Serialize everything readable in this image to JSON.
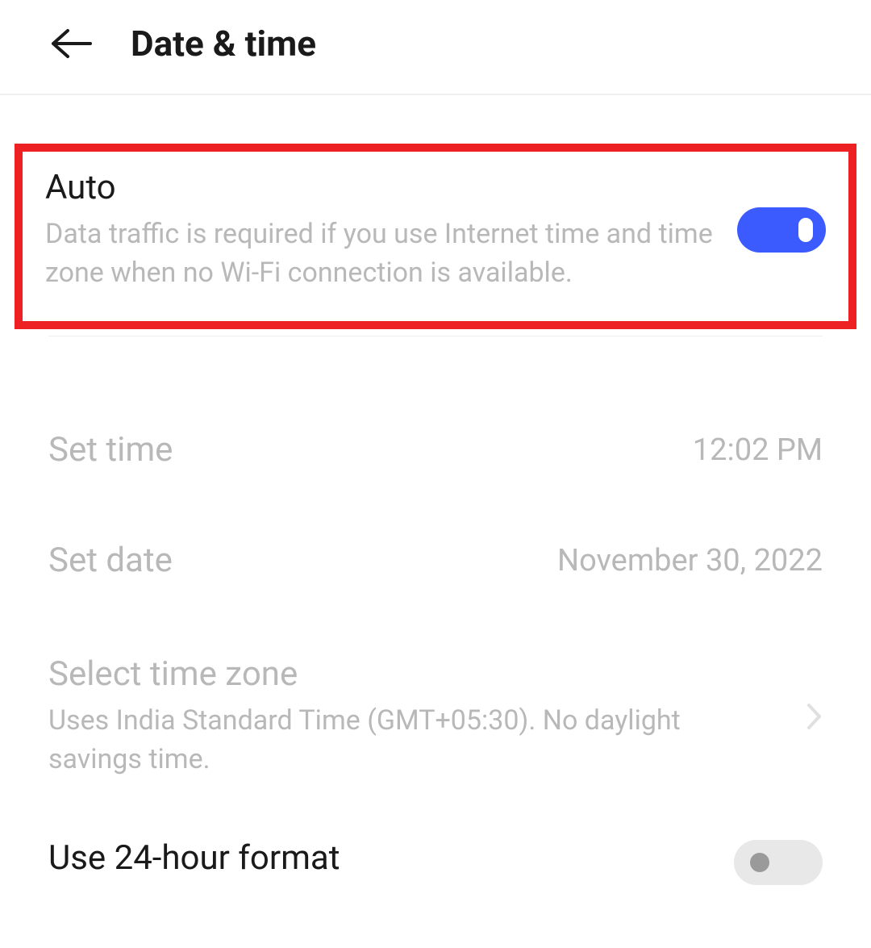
{
  "header": {
    "title": "Date & time"
  },
  "auto": {
    "title": "Auto",
    "desc": "Data traffic is required if you use Internet time and time zone when no Wi-Fi connection is available.",
    "enabled": true
  },
  "set_time": {
    "label": "Set time",
    "value": "12:02 PM"
  },
  "set_date": {
    "label": "Set date",
    "value": "November 30, 2022"
  },
  "time_zone": {
    "label": "Select time zone",
    "desc": "Uses India Standard Time (GMT+05:30). No daylight savings time."
  },
  "hour_format": {
    "label": "Use 24-hour format",
    "enabled": false
  },
  "colors": {
    "highlight": "#ed2024",
    "toggle_on": "#3b5bff"
  }
}
